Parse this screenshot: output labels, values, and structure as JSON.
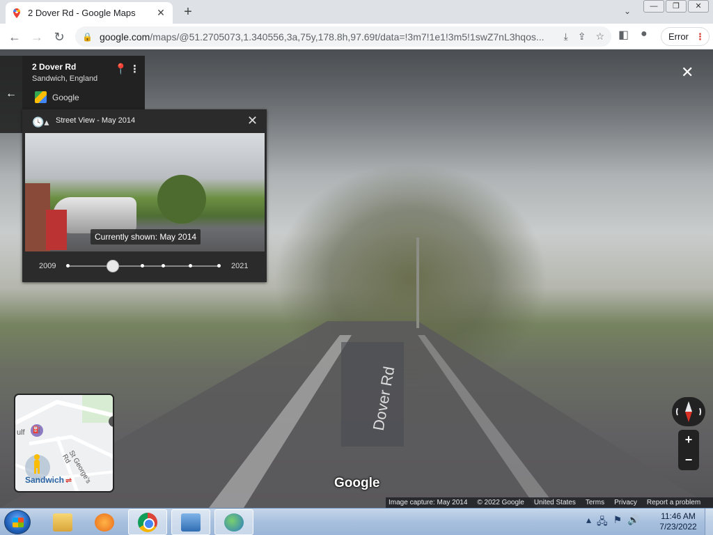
{
  "browser": {
    "tab_title": "2 Dover Rd - Google Maps",
    "tab_close": "✕",
    "new_tab": "+",
    "tab_search": "⌄",
    "url_host": "google.com",
    "url_path": "/maps/@51.2705073,1.340556,3a,75y,178.8h,97.69t/data=!3m7!1e1!3m5!1swZ7nL3hqos...",
    "error_label": "Error",
    "error_dots": "⋮"
  },
  "place": {
    "name": "2 Dover Rd",
    "locality": "Sandwich, England",
    "source": "Google"
  },
  "time_machine": {
    "title": "Street View - May 2014",
    "currently_shown": "Currently shown: May 2014",
    "start_year": "2009",
    "end_year": "2021",
    "selected_index": 1,
    "available_dates_count": 6
  },
  "minimap": {
    "town_label": "Sandwich",
    "gulf_label": "ulf",
    "road_label": "St George's Rd"
  },
  "panorama": {
    "watermark": "Google",
    "road_marking": "Dover Rd"
  },
  "credits": {
    "capture": "Image capture: May 2014",
    "copyright": "© 2022 Google",
    "region": "United States",
    "terms": "Terms",
    "privacy": "Privacy",
    "report": "Report a problem"
  },
  "controls": {
    "zoom_in": "+",
    "zoom_out": "−",
    "close_pano": "✕"
  },
  "taskbar": {
    "time": "11:46 AM",
    "date": "7/23/2022"
  }
}
